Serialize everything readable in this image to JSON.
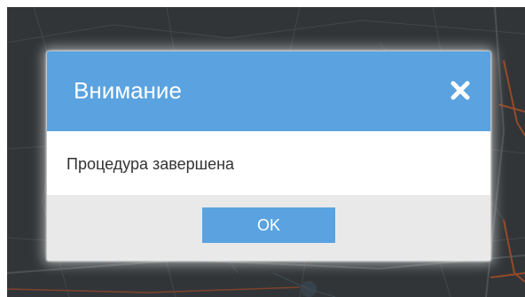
{
  "dialog": {
    "title": "Внимание",
    "close_icon": "close-x-icon",
    "message": "Процедура завершена",
    "ok_label": "OK"
  },
  "colors": {
    "header": "#5aa3e0",
    "button": "#5aa3e0",
    "footer": "#e9e9e9",
    "map_background": "#36393b"
  }
}
